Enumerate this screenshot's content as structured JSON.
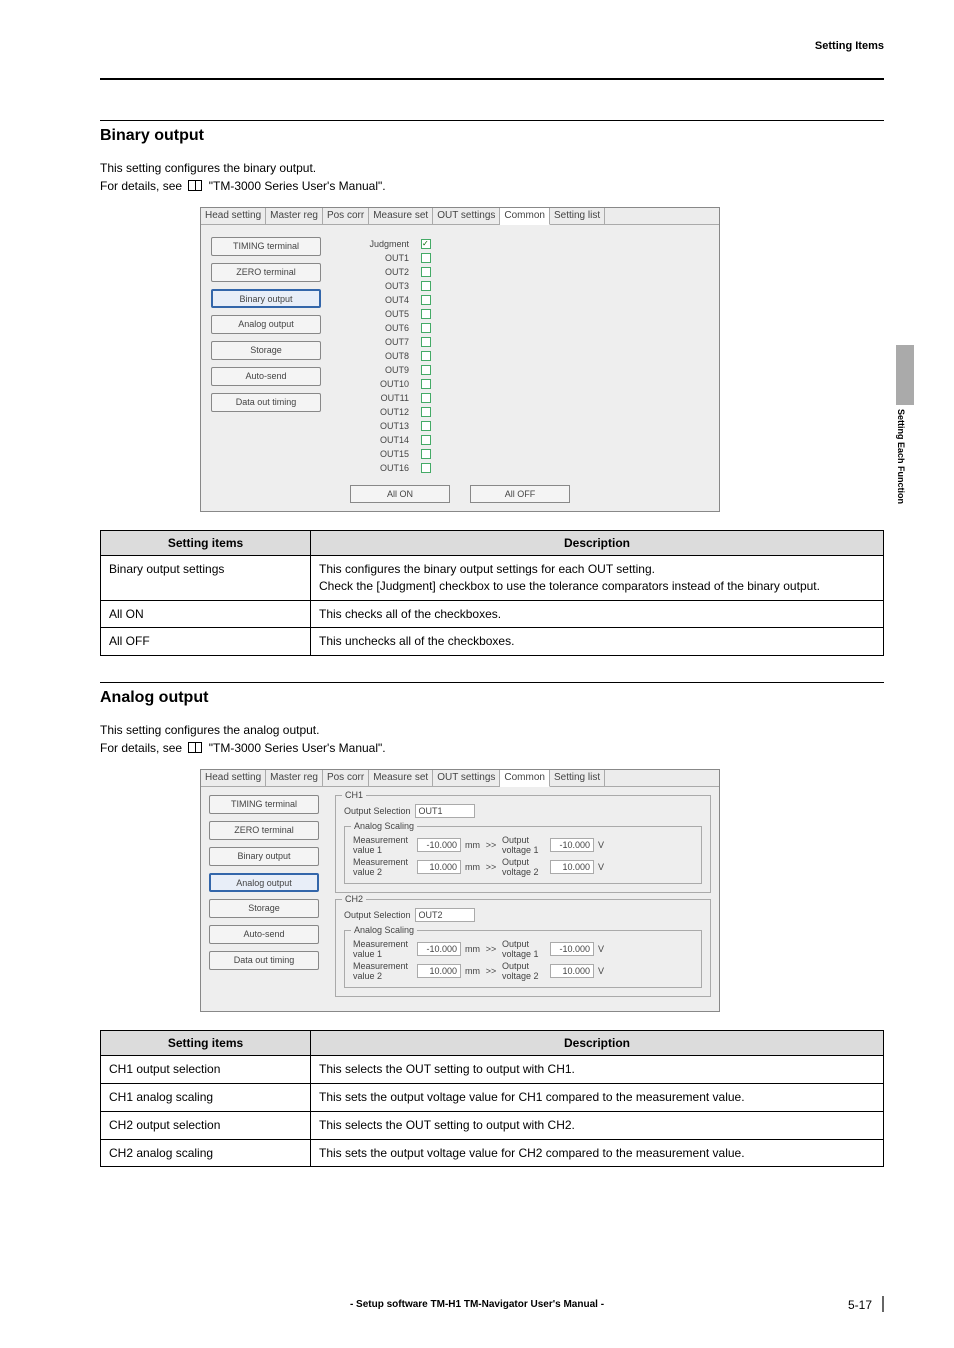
{
  "header": {
    "topRight": "Setting Items"
  },
  "sideTab": {
    "label": "Setting Each Function"
  },
  "binary": {
    "title": "Binary output",
    "intro1": "This setting configures the binary output.",
    "intro2a": "For details, see",
    "intro2b": "\"TM-3000 Series User's Manual\".",
    "shot": {
      "tabs": [
        "Head setting",
        "Master reg",
        "Pos corr",
        "Measure set",
        "OUT settings",
        "Common",
        "Setting list"
      ],
      "activeTab": "Common",
      "sideButtons": [
        "TIMING terminal",
        "ZERO terminal",
        "Binary output",
        "Analog output",
        "Storage",
        "Auto-send",
        "Data out timing"
      ],
      "activeSide": "Binary output",
      "rows": [
        {
          "label": "Judgment",
          "checked": true
        },
        {
          "label": "OUT1",
          "checked": false
        },
        {
          "label": "OUT2",
          "checked": false
        },
        {
          "label": "OUT3",
          "checked": false
        },
        {
          "label": "OUT4",
          "checked": false
        },
        {
          "label": "OUT5",
          "checked": false
        },
        {
          "label": "OUT6",
          "checked": false
        },
        {
          "label": "OUT7",
          "checked": false
        },
        {
          "label": "OUT8",
          "checked": false
        },
        {
          "label": "OUT9",
          "checked": false
        },
        {
          "label": "OUT10",
          "checked": false
        },
        {
          "label": "OUT11",
          "checked": false
        },
        {
          "label": "OUT12",
          "checked": false
        },
        {
          "label": "OUT13",
          "checked": false
        },
        {
          "label": "OUT14",
          "checked": false
        },
        {
          "label": "OUT15",
          "checked": false
        },
        {
          "label": "OUT16",
          "checked": false
        }
      ],
      "allOn": "All ON",
      "allOff": "All OFF"
    },
    "table": {
      "head": {
        "c1": "Setting items",
        "c2": "Description"
      },
      "rows": [
        {
          "c1": "Binary output settings",
          "c2": "This configures the binary output settings for each OUT setting.\nCheck the [Judgment] checkbox to use the tolerance comparators instead of the binary output."
        },
        {
          "c1": "All ON",
          "c2": "This checks all of the checkboxes."
        },
        {
          "c1": "All OFF",
          "c2": "This unchecks all of the checkboxes."
        }
      ]
    }
  },
  "analog": {
    "title": "Analog output",
    "intro1": "This setting configures the analog output.",
    "intro2a": "For details, see",
    "intro2b": "\"TM-3000 Series User's Manual\".",
    "shot": {
      "tabs": [
        "Head setting",
        "Master reg",
        "Pos corr",
        "Measure set",
        "OUT settings",
        "Common",
        "Setting list"
      ],
      "activeTab": "Common",
      "sideButtons": [
        "TIMING terminal",
        "ZERO terminal",
        "Binary output",
        "Analog output",
        "Storage",
        "Auto-send",
        "Data out timing"
      ],
      "activeSide": "Analog output",
      "ch1": {
        "title": "CH1",
        "outSelLabel": "Output Selection",
        "outSelValue": "OUT1",
        "scalingTitle": "Analog Scaling",
        "row1": {
          "leftLabel": "Measurement value 1",
          "leftVal": "-10.000",
          "leftUnit": "mm",
          "arrow": ">>",
          "rightLabel": "Output voltage 1",
          "rightVal": "-10.000",
          "rightUnit": "V"
        },
        "row2": {
          "leftLabel": "Measurement value 2",
          "leftVal": "10.000",
          "leftUnit": "mm",
          "arrow": ">>",
          "rightLabel": "Output voltage 2",
          "rightVal": "10.000",
          "rightUnit": "V"
        }
      },
      "ch2": {
        "title": "CH2",
        "outSelLabel": "Output Selection",
        "outSelValue": "OUT2",
        "scalingTitle": "Analog Scaling",
        "row1": {
          "leftLabel": "Measurement value 1",
          "leftVal": "-10.000",
          "leftUnit": "mm",
          "arrow": ">>",
          "rightLabel": "Output voltage 1",
          "rightVal": "-10.000",
          "rightUnit": "V"
        },
        "row2": {
          "leftLabel": "Measurement value 2",
          "leftVal": "10.000",
          "leftUnit": "mm",
          "arrow": ">>",
          "rightLabel": "Output voltage 2",
          "rightVal": "10.000",
          "rightUnit": "V"
        }
      }
    },
    "table": {
      "head": {
        "c1": "Setting items",
        "c2": "Description"
      },
      "rows": [
        {
          "c1": "CH1 output selection",
          "c2": "This selects the OUT setting to output with CH1."
        },
        {
          "c1": "CH1 analog scaling",
          "c2": "This sets the output voltage value for CH1 compared to the measurement value."
        },
        {
          "c1": "CH2 output selection",
          "c2": "This selects the OUT setting to output with CH2."
        },
        {
          "c1": "CH2 analog scaling",
          "c2": "This sets the output voltage value for CH2 compared to the measurement value."
        }
      ]
    }
  },
  "footer": {
    "text": "- Setup software TM-H1 TM-Navigator User's Manual -",
    "pageNum": "5-17"
  }
}
